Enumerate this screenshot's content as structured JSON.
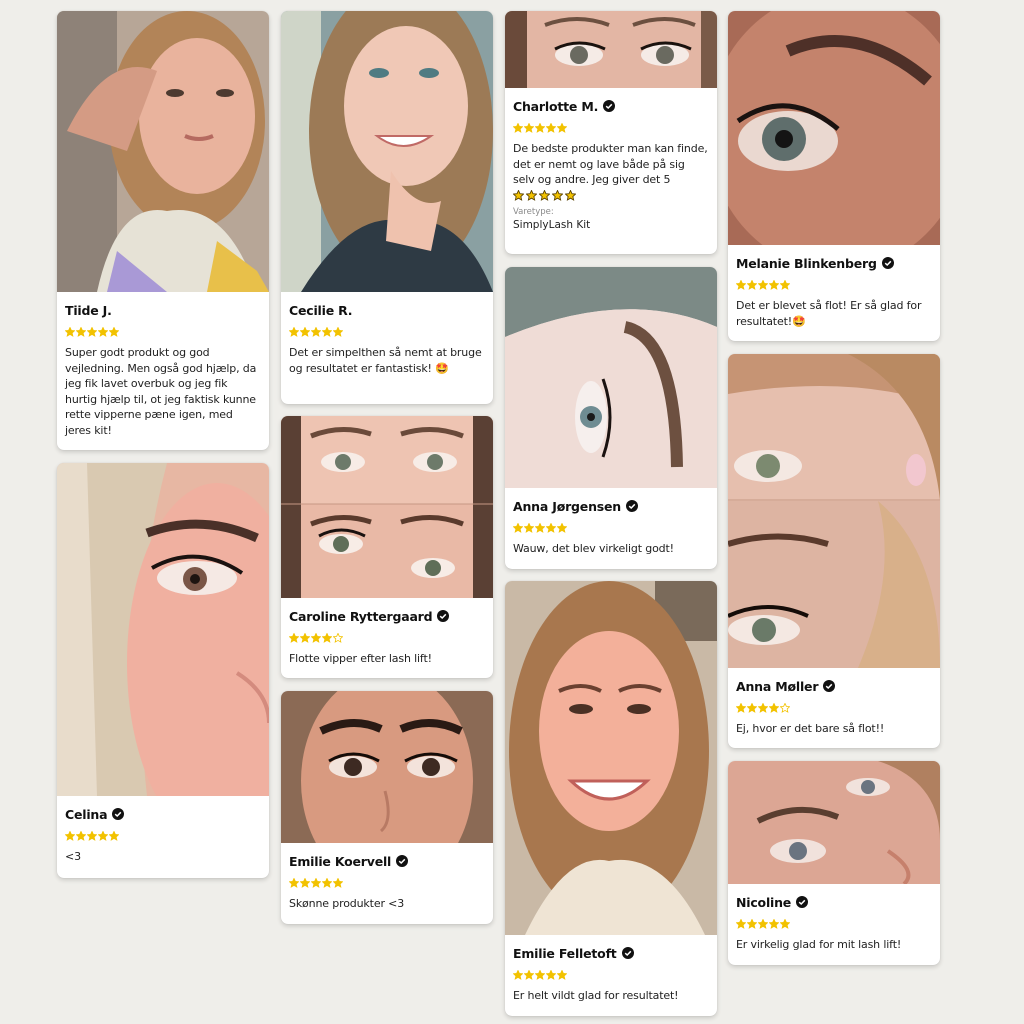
{
  "colors": {
    "background": "#efeeea",
    "star": "#f2c200",
    "verified": "#111111",
    "card": "#ffffff"
  },
  "reviews": [
    {
      "name": "Tiide J.",
      "verified": false,
      "rating": 5,
      "text": "Super godt produkt og god vejledning. Men også god hjælp, da jeg fik lavet overbuk og jeg fik hurtig hjælp til, ot jeg faktisk kunne rette vipperne pæne igen, med jeres kit!",
      "photo": "selfie"
    },
    {
      "name": "Celina",
      "verified": true,
      "rating": 5,
      "text": "<3",
      "photo": "eye-closeup"
    },
    {
      "name": "Cecilie R.",
      "verified": false,
      "rating": 5,
      "text": "Det er simpelthen så nemt at bruge og resultatet er fantastisk! 🤩",
      "photo": "selfie"
    },
    {
      "name": "Caroline Ryttergaard",
      "verified": true,
      "rating": 4,
      "text": "Flotte vipper efter lash lift!",
      "photo": "before-after-eyes"
    },
    {
      "name": "Emilie Koervell",
      "verified": true,
      "rating": 5,
      "text": "Skønne produkter <3",
      "photo": "eyes"
    },
    {
      "name": "Charlotte M.",
      "verified": true,
      "rating": 5,
      "text": "De bedste produkter man kan finde, det er nemt og lave både på sig selv og andre. Jeg giver det 5",
      "text_stars": 5,
      "variant_label": "Varetype:",
      "variant_value": "SimplyLash Kit",
      "photo": "eyes"
    },
    {
      "name": "Anna Jørgensen",
      "verified": true,
      "rating": 5,
      "text": "Wauw, det blev virkeligt godt!",
      "photo": "eye-side"
    },
    {
      "name": "Emilie Felletoft",
      "verified": true,
      "rating": 5,
      "text": "Er helt vildt glad for resultatet!",
      "photo": "selfie-smile"
    },
    {
      "name": "Melanie Blinkenberg",
      "verified": true,
      "rating": 5,
      "text": "Det er blevet så flot! Er så glad for resultatet!🤩",
      "photo": "eye-closeup"
    },
    {
      "name": "Anna Møller",
      "verified": true,
      "rating": 4,
      "text": "Ej, hvor er det bare så flot!!",
      "photo": "before-after-eye"
    },
    {
      "name": "Nicoline",
      "verified": true,
      "rating": 5,
      "text": "Er virkelig glad for mit lash lift!",
      "photo": "eyes"
    }
  ]
}
